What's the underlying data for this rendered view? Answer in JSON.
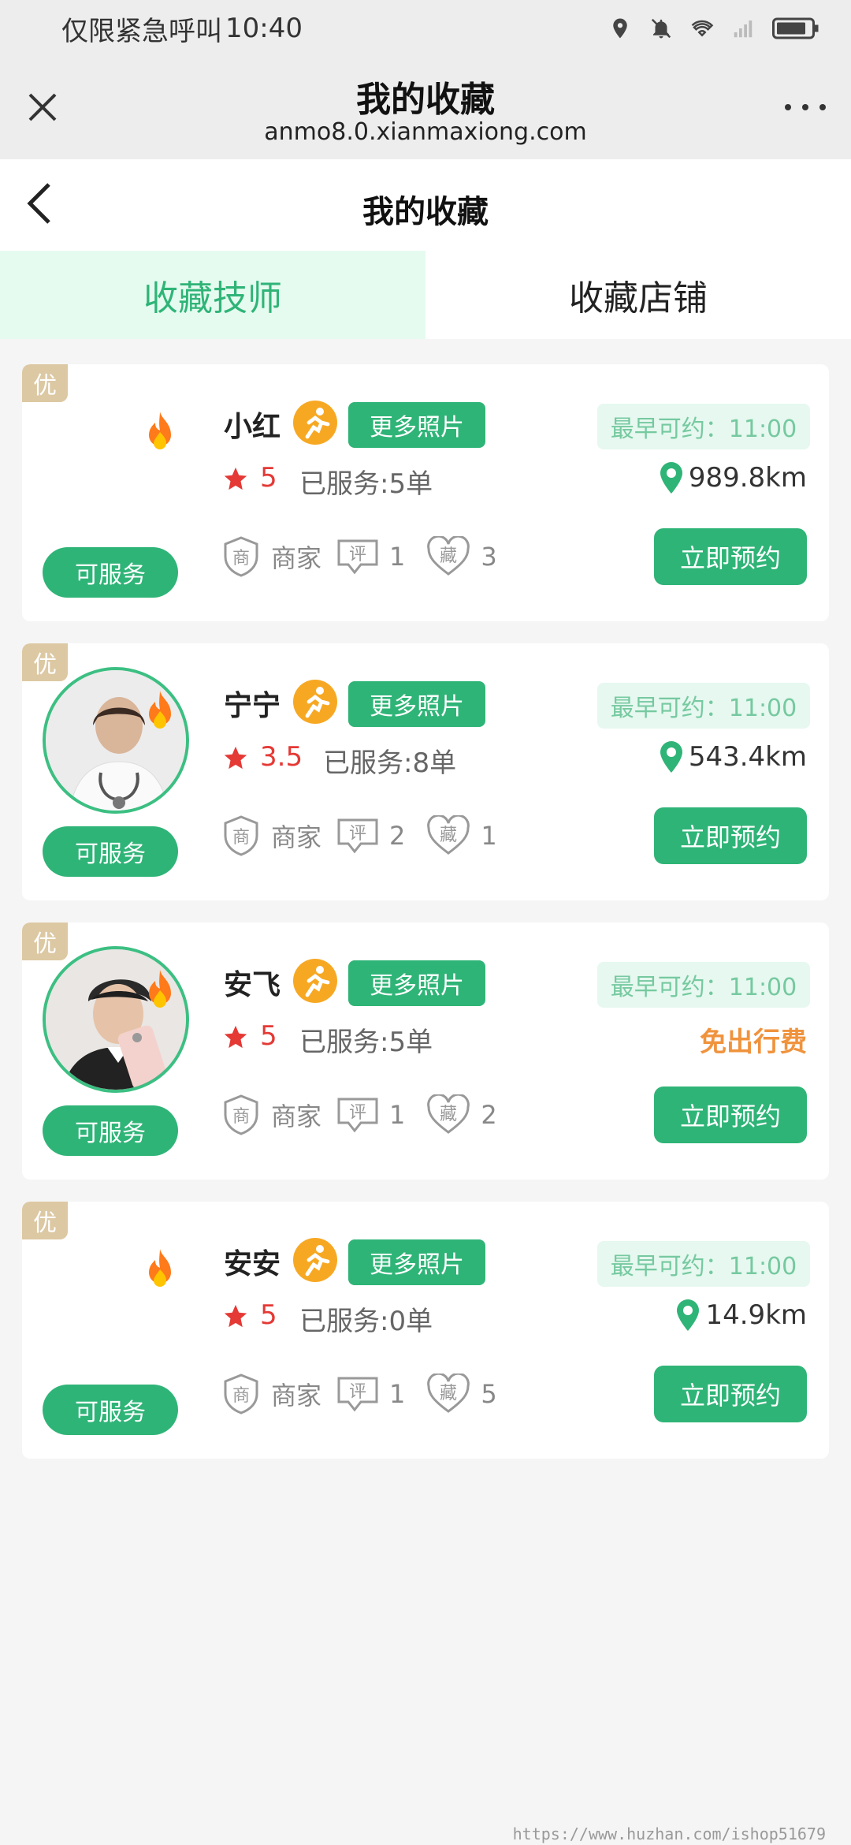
{
  "status_bar": {
    "carrier": "仅限紧急呼叫",
    "time": "10:40"
  },
  "webview": {
    "title": "我的收藏",
    "url": "anmo8.0.xianmaxiong.com"
  },
  "page": {
    "title": "我的收藏"
  },
  "tabs": [
    {
      "label": "收藏技师",
      "active": true
    },
    {
      "label": "收藏店铺",
      "active": false
    }
  ],
  "labels": {
    "badge": "优",
    "service": "可服务",
    "more_photos": "更多照片",
    "earliest": "最早可约：11:00",
    "book": "立即预约",
    "merchant": "商家",
    "comment_icon": "评",
    "fav_icon": "藏",
    "merchant_icon": "商"
  },
  "technicians": [
    {
      "name": "小红",
      "rating": "5",
      "served": "已服务:5单",
      "distance": "989.8km",
      "comments": "1",
      "favorites": "3",
      "has_avatar": false
    },
    {
      "name": "宁宁",
      "rating": "3.5",
      "served": "已服务:8单",
      "distance": "543.4km",
      "comments": "2",
      "favorites": "1",
      "has_avatar": true
    },
    {
      "name": "安飞",
      "rating": "5",
      "served": "已服务:5单",
      "distance": "免出行费",
      "comments": "1",
      "favorites": "2",
      "has_avatar": true
    },
    {
      "name": "安安",
      "rating": "5",
      "served": "已服务:0单",
      "distance": "14.9km",
      "comments": "1",
      "favorites": "5",
      "has_avatar": false
    }
  ],
  "watermark": "https://www.huzhan.com/ishop51679",
  "colors": {
    "accent": "#2fb477",
    "rating": "#e53935",
    "free_travel": "#f0933d",
    "badge": "#dcc8a2"
  }
}
